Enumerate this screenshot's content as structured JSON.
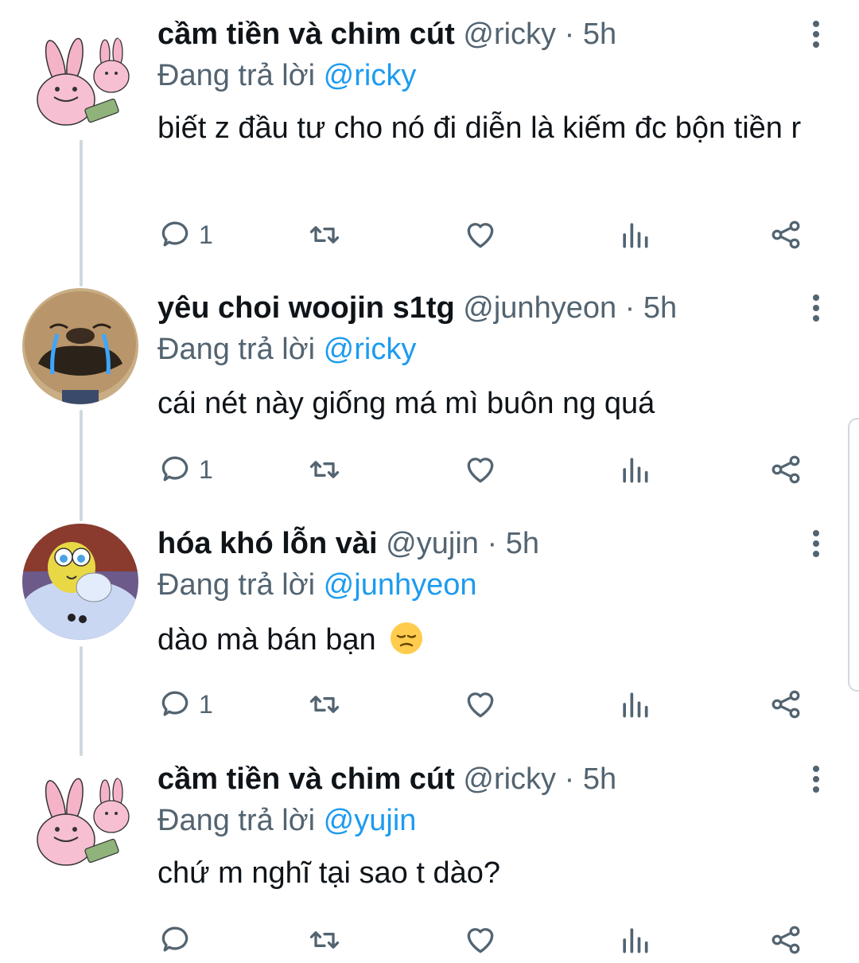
{
  "tweets": [
    {
      "name": "cầm tiền và chim cút",
      "handle": "@ricky",
      "dot": "·",
      "time": "5h",
      "reply_prefix": "Đang trả lời",
      "reply_to": "@ricky",
      "text": "biết z đầu tư cho nó đi diễn là kiếm đc bộn tiền r",
      "reply_count": "1",
      "avatar": "pink-rabbit-avatar"
    },
    {
      "name": "yêu choi woojin s1tg",
      "handle": "@junhyeon",
      "dot": "·",
      "time": "5h",
      "reply_prefix": "Đang trả lời",
      "reply_to": "@ricky",
      "text": "cái nét này giống má mì buôn ng quá",
      "reply_count": "1",
      "avatar": "crying-dog-avatar"
    },
    {
      "name": "hóa khó lỗn vài",
      "handle": "@yujin",
      "dot": "·",
      "time": "5h",
      "reply_prefix": "Đang trả lời",
      "reply_to": "@junhyeon",
      "text": "dào mà bán bạn",
      "reply_count": "1",
      "avatar": "crying-sponge-avatar"
    },
    {
      "name": "cầm tiền và chim cút",
      "handle": "@ricky",
      "dot": "·",
      "time": "5h",
      "reply_prefix": "Đang trả lời",
      "reply_to": "@yujin",
      "text": "chứ m nghĩ tại sao t dào?",
      "reply_count": "",
      "avatar": "pink-rabbit-avatar"
    }
  ],
  "icons": {
    "reply": "reply-icon",
    "retweet": "retweet-icon",
    "like": "heart-icon",
    "views": "views-icon",
    "share": "share-icon",
    "more": "more-icon",
    "emoji": "pensive-face-emoji"
  },
  "colors": {
    "link": "#1d9bf0",
    "secondary": "#536471",
    "thread_line": "#cfd9de"
  }
}
